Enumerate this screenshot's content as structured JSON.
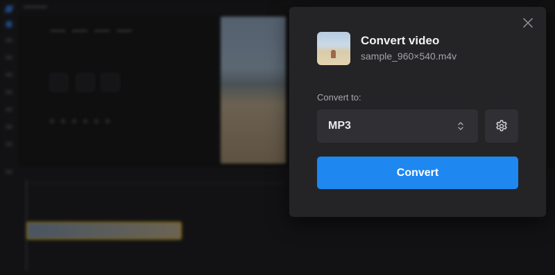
{
  "dialog": {
    "title": "Convert video",
    "filename": "sample_960×540.m4v",
    "convert_to_label": "Convert to:",
    "format_select": {
      "value": "MP3"
    },
    "convert_button_label": "Convert",
    "icons": {
      "close": "close-icon",
      "thumbnail": "video-thumbnail",
      "select_arrows": "chevron-up-down-icon",
      "settings": "gear-icon"
    },
    "colors": {
      "primary_button": "#1e87f0",
      "panel": "#242427",
      "field": "#303034"
    }
  }
}
